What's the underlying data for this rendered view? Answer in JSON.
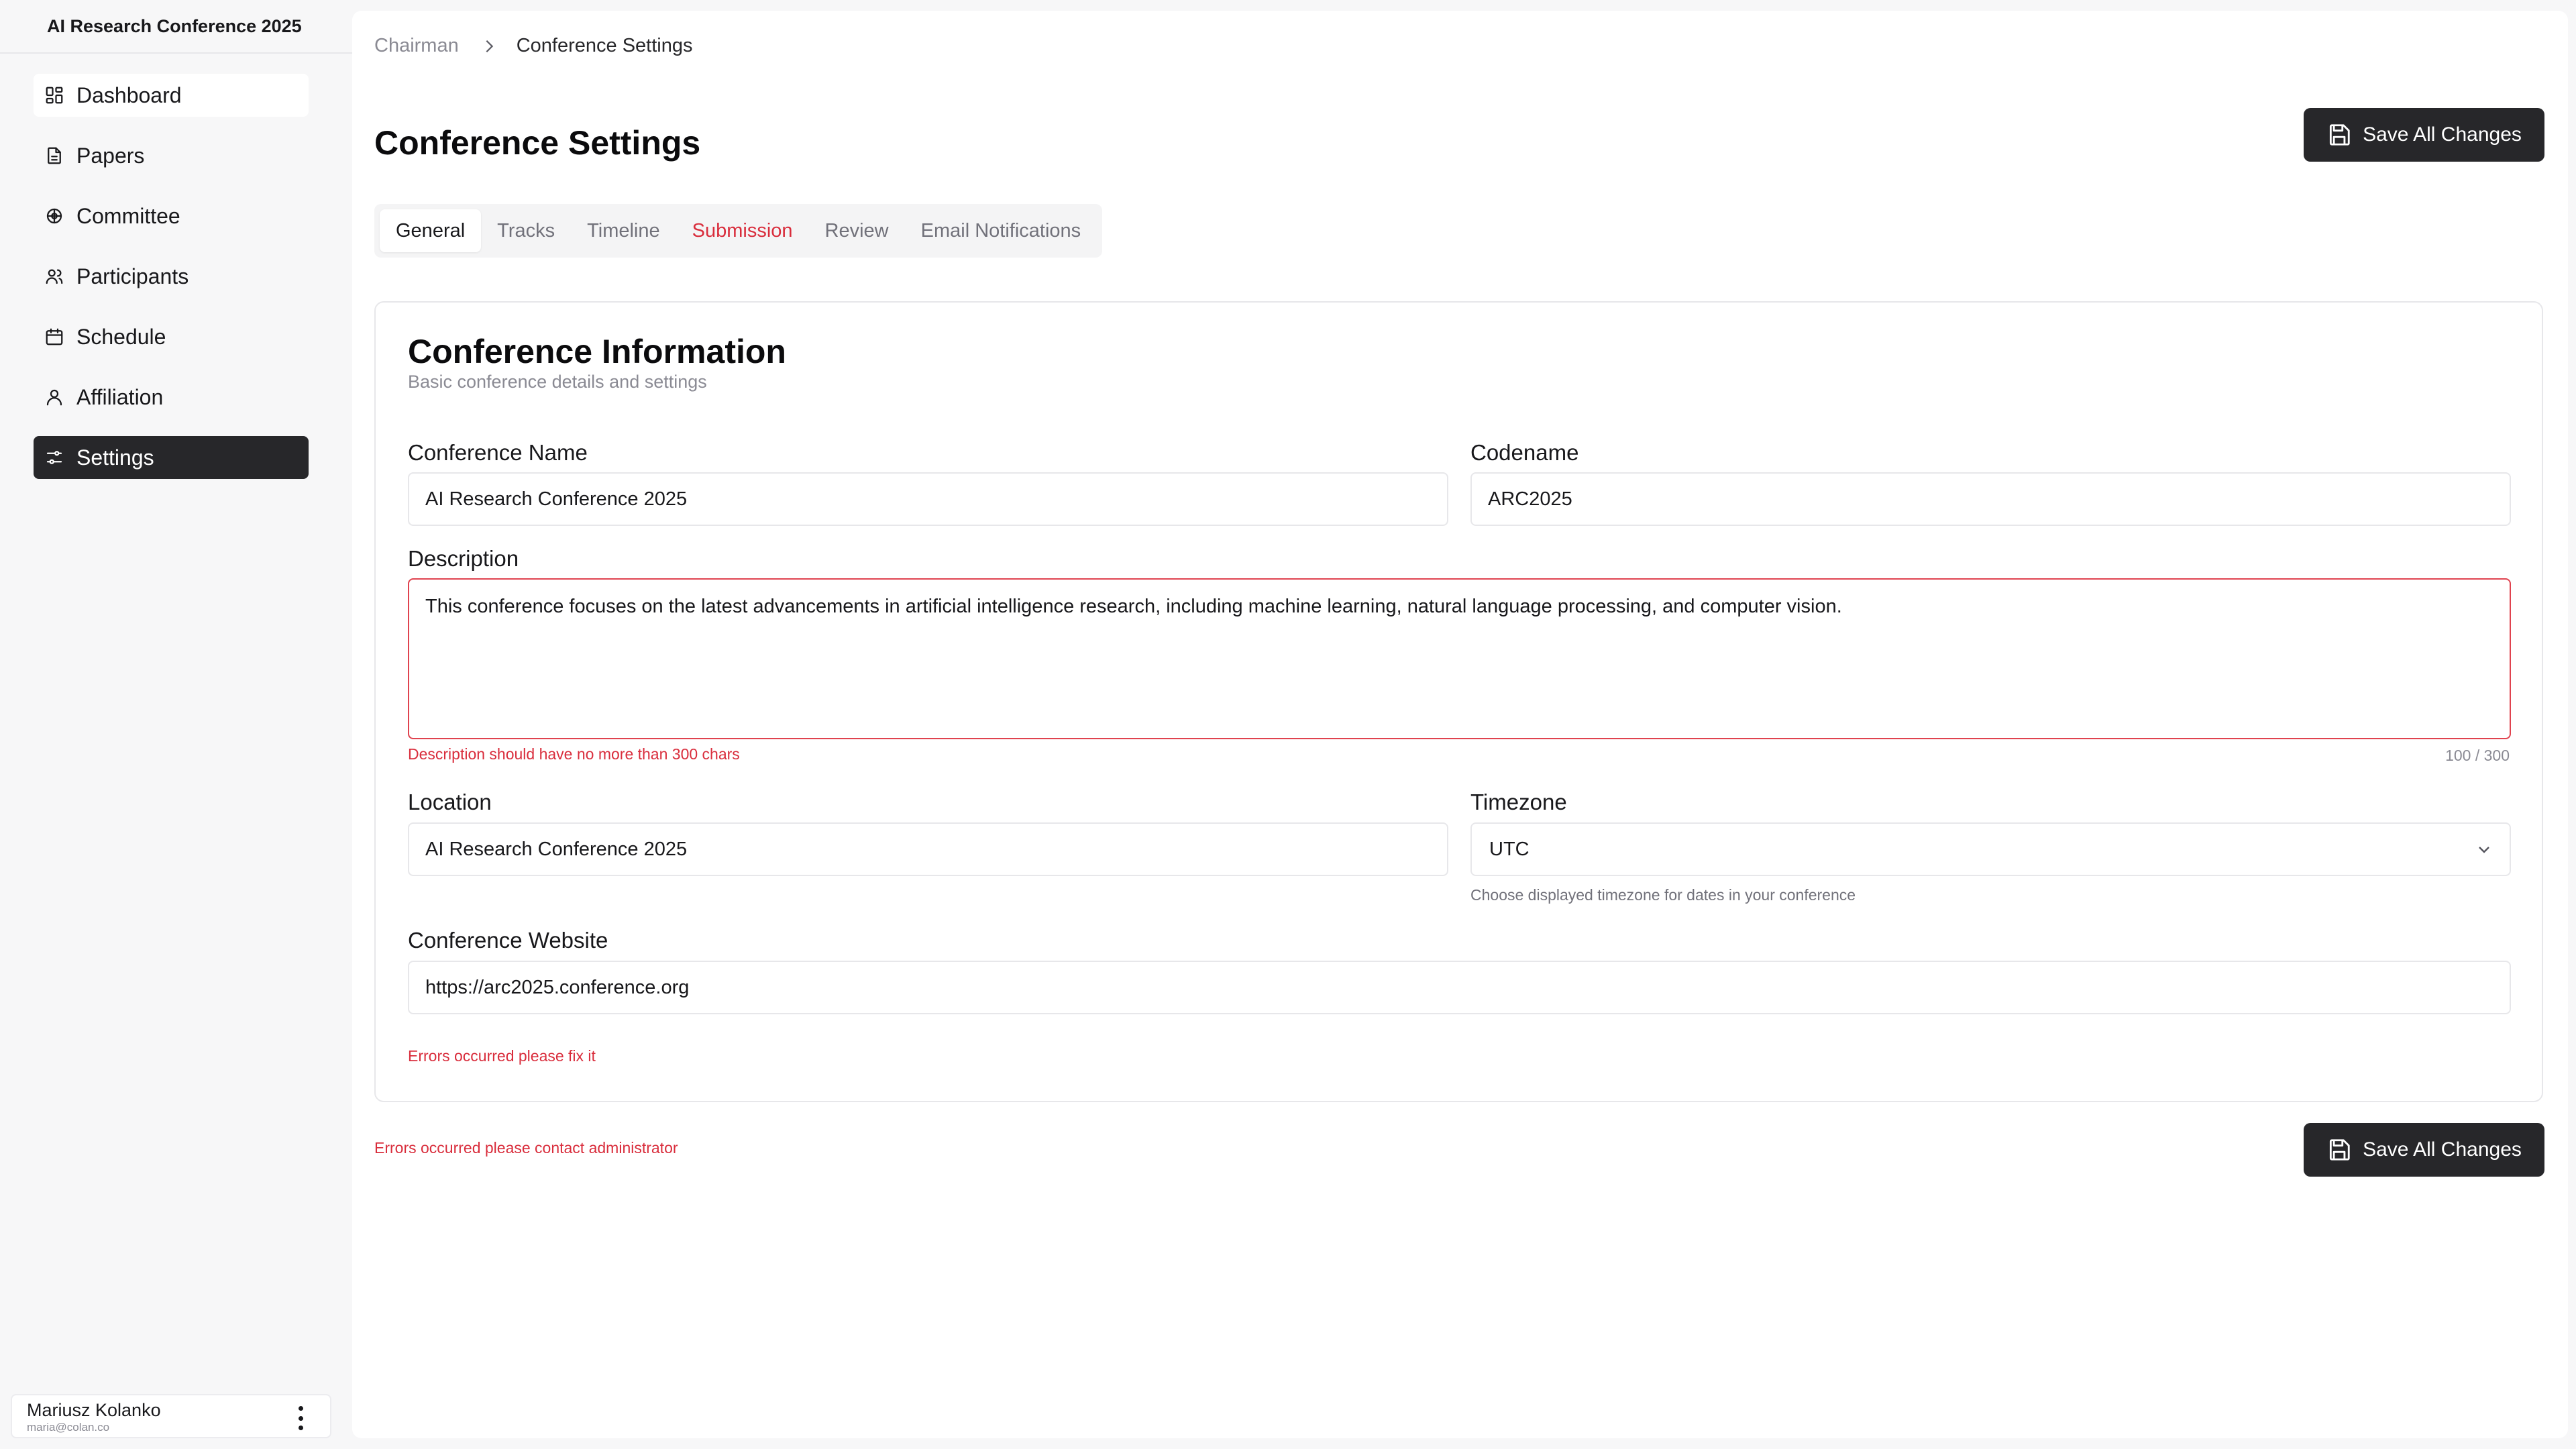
{
  "app": {
    "title": "AI Research Conference 2025"
  },
  "sidebar": {
    "items": [
      {
        "label": "Dashboard",
        "icon": "dashboard-icon"
      },
      {
        "label": "Papers",
        "icon": "document-icon"
      },
      {
        "label": "Committee",
        "icon": "committee-icon"
      },
      {
        "label": "Participants",
        "icon": "users-icon"
      },
      {
        "label": "Schedule",
        "icon": "calendar-icon"
      },
      {
        "label": "Affiliation",
        "icon": "user-icon"
      },
      {
        "label": "Settings",
        "icon": "settings-sliders-icon",
        "active": true
      }
    ]
  },
  "user": {
    "name": "Mariusz Kolanko",
    "email": "maria@colan.co"
  },
  "breadcrumb": {
    "parent": "Chairman",
    "current": "Conference Settings"
  },
  "page": {
    "title": "Conference Settings",
    "save_label": "Save All Changes"
  },
  "tabs": [
    {
      "label": "General",
      "state": "active"
    },
    {
      "label": "Tracks",
      "state": "default"
    },
    {
      "label": "Timeline",
      "state": "default"
    },
    {
      "label": "Submission",
      "state": "error"
    },
    {
      "label": "Review",
      "state": "default"
    },
    {
      "label": "Email Notifications",
      "state": "default"
    }
  ],
  "card": {
    "title": "Conference Information",
    "subtitle": "Basic conference details and settings",
    "fields": {
      "name": {
        "label": "Conference Name",
        "value": "AI Research Conference 2025"
      },
      "codename": {
        "label": "Codename",
        "value": "ARC2025"
      },
      "description": {
        "label": "Description",
        "value": "This conference focuses on the latest advancements in artificial intelligence research, including machine learning, natural language processing, and computer vision.",
        "error": "Description should have no more than 300 chars",
        "counter": "100 / 300"
      },
      "location": {
        "label": "Location",
        "value": "AI Research Conference 2025"
      },
      "timezone": {
        "label": "Timezone",
        "value": "UTC",
        "helper": "Choose displayed timezone for dates in your conference"
      },
      "website": {
        "label": "Conference Website",
        "value": "https://arc2025.conference.org"
      }
    },
    "form_error": "Errors occurred please fix it"
  },
  "footer": {
    "error": "Errors occurred please contact administrator"
  },
  "colors": {
    "accent_dark": "#27272a",
    "error": "#d92d3c",
    "muted": "#8a8a93"
  }
}
